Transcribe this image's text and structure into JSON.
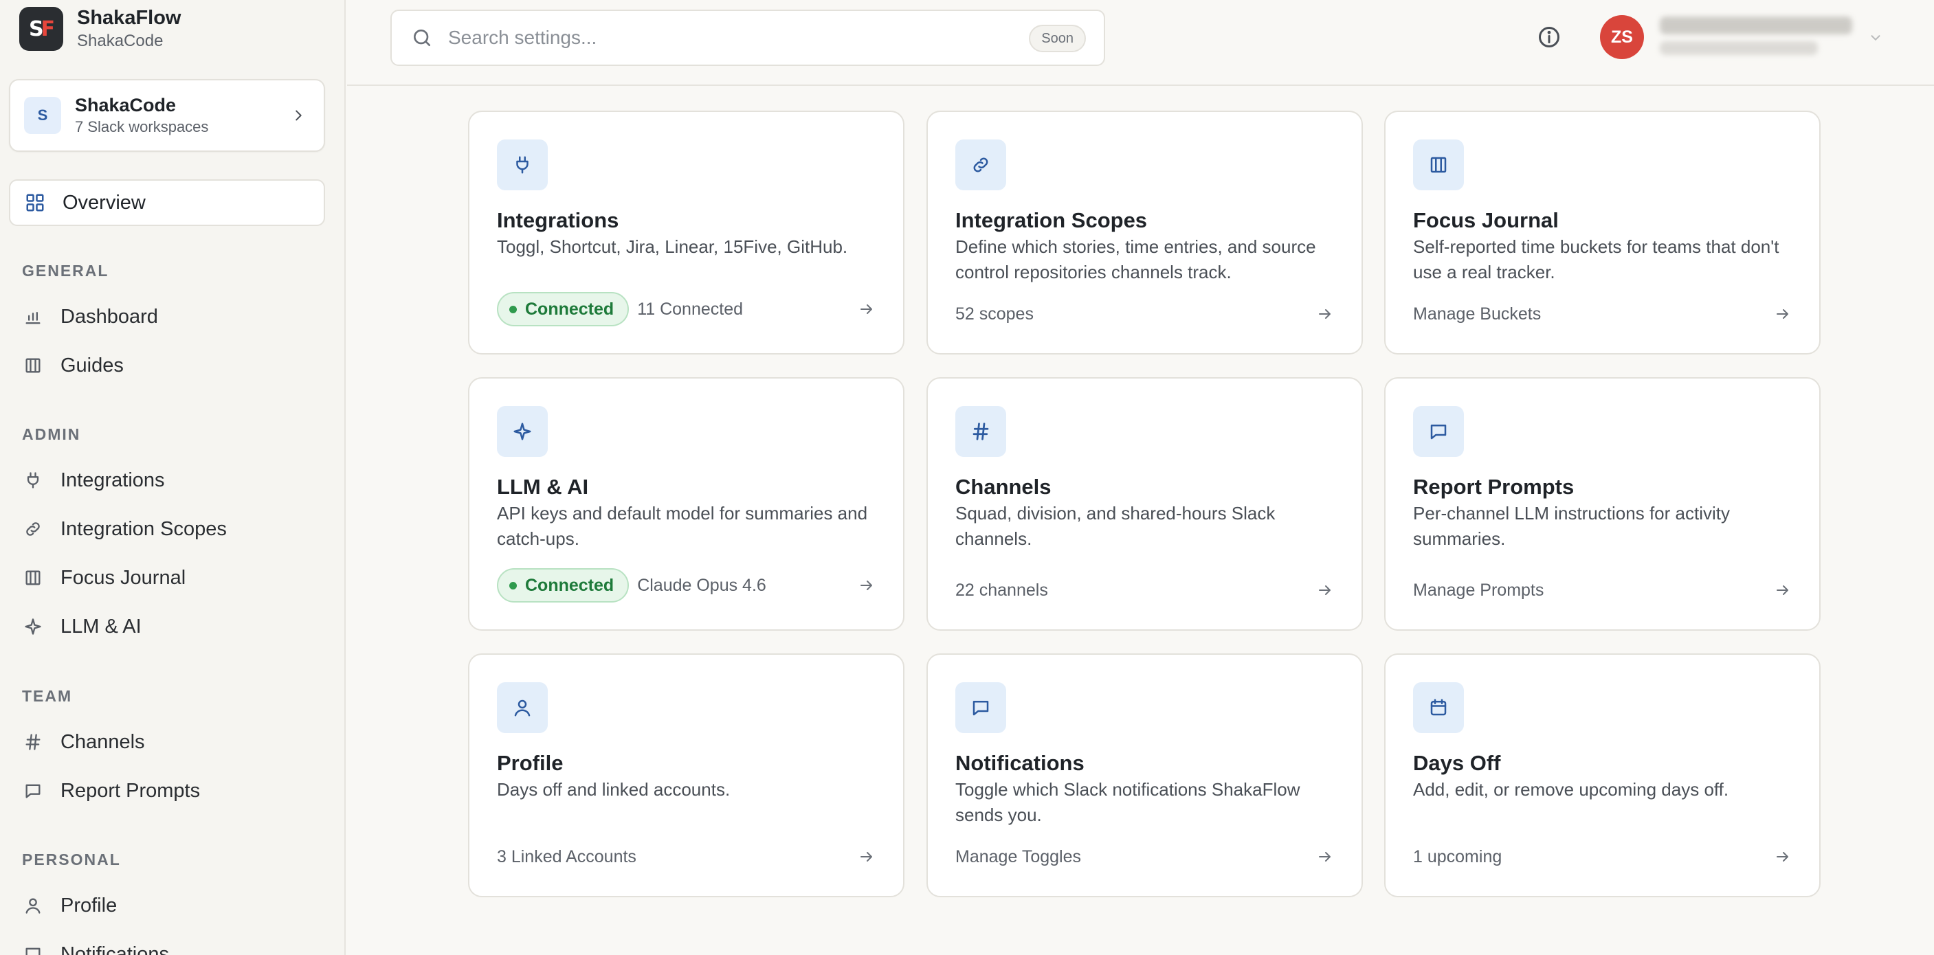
{
  "brand": {
    "logo_text": "SF",
    "title": "ShakaFlow",
    "subtitle": "ShakaCode"
  },
  "workspace": {
    "avatar_letter": "S",
    "name": "ShakaCode",
    "subtitle": "7 Slack workspaces"
  },
  "sidebar": {
    "active": {
      "label": "Overview",
      "icon": "grid-icon"
    },
    "sections": [
      {
        "label": "GENERAL",
        "items": [
          {
            "label": "Dashboard",
            "icon": "bar-chart-icon"
          },
          {
            "label": "Guides",
            "icon": "book-icon"
          }
        ]
      },
      {
        "label": "ADMIN",
        "items": [
          {
            "label": "Integrations",
            "icon": "plug-icon"
          },
          {
            "label": "Integration Scopes",
            "icon": "link-icon"
          },
          {
            "label": "Focus Journal",
            "icon": "book-icon"
          },
          {
            "label": "LLM & AI",
            "icon": "sparkle-icon"
          }
        ]
      },
      {
        "label": "TEAM",
        "items": [
          {
            "label": "Channels",
            "icon": "hash-icon"
          },
          {
            "label": "Report Prompts",
            "icon": "message-icon"
          }
        ]
      },
      {
        "label": "PERSONAL",
        "items": [
          {
            "label": "Profile",
            "icon": "user-icon"
          },
          {
            "label": "Notifications",
            "icon": "message-icon"
          }
        ]
      }
    ]
  },
  "topbar": {
    "search_placeholder": "Search settings...",
    "soon_badge": "Soon",
    "user_initials": "ZS"
  },
  "cards": [
    {
      "title": "Integrations",
      "icon": "plug-icon",
      "description": "Toggl, Shortcut, Jira, Linear, 15Five, GitHub.",
      "badge": "Connected",
      "footer": "11 Connected"
    },
    {
      "title": "Integration Scopes",
      "icon": "link-icon",
      "description": "Define which stories, time entries, and source control repositories channels track.",
      "badge": "",
      "footer": "52 scopes"
    },
    {
      "title": "Focus Journal",
      "icon": "book-icon",
      "description": "Self-reported time buckets for teams that don't use a real tracker.",
      "badge": "",
      "footer": "Manage Buckets"
    },
    {
      "title": "LLM & AI",
      "icon": "sparkle-icon",
      "description": "API keys and default model for summaries and catch-ups.",
      "badge": "Connected",
      "footer": "Claude Opus 4.6"
    },
    {
      "title": "Channels",
      "icon": "hash-icon",
      "description": "Squad, division, and shared-hours Slack channels.",
      "badge": "",
      "footer": "22 channels"
    },
    {
      "title": "Report Prompts",
      "icon": "message-icon",
      "description": "Per-channel LLM instructions for activity summaries.",
      "badge": "",
      "footer": "Manage Prompts"
    },
    {
      "title": "Profile",
      "icon": "user-icon",
      "description": "Days off and linked accounts.",
      "badge": "",
      "footer": "3 Linked Accounts"
    },
    {
      "title": "Notifications",
      "icon": "message-icon",
      "description": "Toggle which Slack notifications ShakaFlow sends you.",
      "badge": "",
      "footer": "Manage Toggles"
    },
    {
      "title": "Days Off",
      "icon": "calendar-icon",
      "description": "Add, edit, or remove upcoming days off.",
      "badge": "",
      "footer": "1 upcoming"
    }
  ],
  "colors": {
    "accent": "#2c5aa0",
    "icon_bg": "#e3eefa",
    "connected_green": "#1e7a3a",
    "avatar_red": "#d9453b",
    "brand_red": "#e8463c"
  }
}
